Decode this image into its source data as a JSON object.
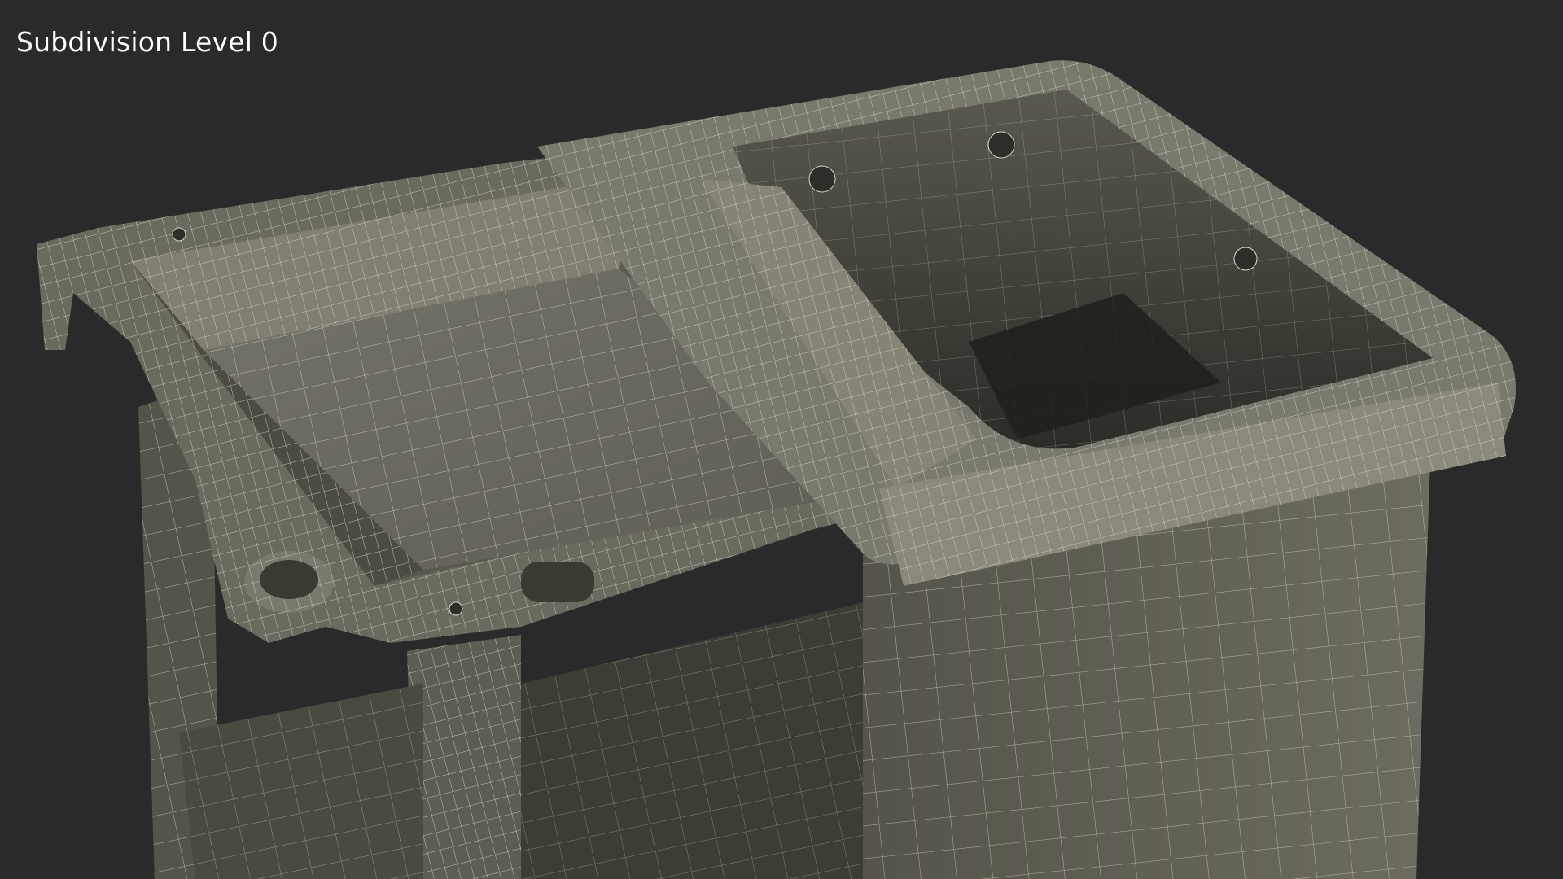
{
  "overlay": {
    "label": "Subdivision Level 0"
  },
  "scene": {
    "subject": "wireframe-render-cart-top",
    "colors": {
      "background": "#292a2a",
      "surface": "#6b6a5e",
      "surface_dark": "#4d4c43",
      "surface_light": "#8a897c",
      "wire": "#d9d8cc",
      "label": "#ffffff"
    }
  }
}
